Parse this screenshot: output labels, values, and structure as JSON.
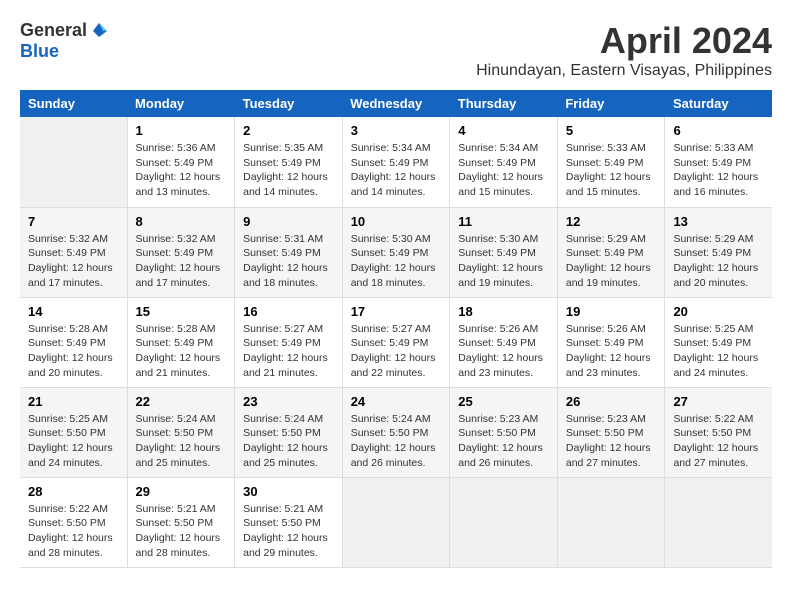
{
  "header": {
    "logo_general": "General",
    "logo_blue": "Blue",
    "month_title": "April 2024",
    "location": "Hinundayan, Eastern Visayas, Philippines"
  },
  "days_of_week": [
    "Sunday",
    "Monday",
    "Tuesday",
    "Wednesday",
    "Thursday",
    "Friday",
    "Saturday"
  ],
  "weeks": [
    [
      {
        "day": "",
        "info": ""
      },
      {
        "day": "1",
        "info": "Sunrise: 5:36 AM\nSunset: 5:49 PM\nDaylight: 12 hours\nand 13 minutes."
      },
      {
        "day": "2",
        "info": "Sunrise: 5:35 AM\nSunset: 5:49 PM\nDaylight: 12 hours\nand 14 minutes."
      },
      {
        "day": "3",
        "info": "Sunrise: 5:34 AM\nSunset: 5:49 PM\nDaylight: 12 hours\nand 14 minutes."
      },
      {
        "day": "4",
        "info": "Sunrise: 5:34 AM\nSunset: 5:49 PM\nDaylight: 12 hours\nand 15 minutes."
      },
      {
        "day": "5",
        "info": "Sunrise: 5:33 AM\nSunset: 5:49 PM\nDaylight: 12 hours\nand 15 minutes."
      },
      {
        "day": "6",
        "info": "Sunrise: 5:33 AM\nSunset: 5:49 PM\nDaylight: 12 hours\nand 16 minutes."
      }
    ],
    [
      {
        "day": "7",
        "info": "Sunrise: 5:32 AM\nSunset: 5:49 PM\nDaylight: 12 hours\nand 17 minutes."
      },
      {
        "day": "8",
        "info": "Sunrise: 5:32 AM\nSunset: 5:49 PM\nDaylight: 12 hours\nand 17 minutes."
      },
      {
        "day": "9",
        "info": "Sunrise: 5:31 AM\nSunset: 5:49 PM\nDaylight: 12 hours\nand 18 minutes."
      },
      {
        "day": "10",
        "info": "Sunrise: 5:30 AM\nSunset: 5:49 PM\nDaylight: 12 hours\nand 18 minutes."
      },
      {
        "day": "11",
        "info": "Sunrise: 5:30 AM\nSunset: 5:49 PM\nDaylight: 12 hours\nand 19 minutes."
      },
      {
        "day": "12",
        "info": "Sunrise: 5:29 AM\nSunset: 5:49 PM\nDaylight: 12 hours\nand 19 minutes."
      },
      {
        "day": "13",
        "info": "Sunrise: 5:29 AM\nSunset: 5:49 PM\nDaylight: 12 hours\nand 20 minutes."
      }
    ],
    [
      {
        "day": "14",
        "info": "Sunrise: 5:28 AM\nSunset: 5:49 PM\nDaylight: 12 hours\nand 20 minutes."
      },
      {
        "day": "15",
        "info": "Sunrise: 5:28 AM\nSunset: 5:49 PM\nDaylight: 12 hours\nand 21 minutes."
      },
      {
        "day": "16",
        "info": "Sunrise: 5:27 AM\nSunset: 5:49 PM\nDaylight: 12 hours\nand 21 minutes."
      },
      {
        "day": "17",
        "info": "Sunrise: 5:27 AM\nSunset: 5:49 PM\nDaylight: 12 hours\nand 22 minutes."
      },
      {
        "day": "18",
        "info": "Sunrise: 5:26 AM\nSunset: 5:49 PM\nDaylight: 12 hours\nand 23 minutes."
      },
      {
        "day": "19",
        "info": "Sunrise: 5:26 AM\nSunset: 5:49 PM\nDaylight: 12 hours\nand 23 minutes."
      },
      {
        "day": "20",
        "info": "Sunrise: 5:25 AM\nSunset: 5:49 PM\nDaylight: 12 hours\nand 24 minutes."
      }
    ],
    [
      {
        "day": "21",
        "info": "Sunrise: 5:25 AM\nSunset: 5:50 PM\nDaylight: 12 hours\nand 24 minutes."
      },
      {
        "day": "22",
        "info": "Sunrise: 5:24 AM\nSunset: 5:50 PM\nDaylight: 12 hours\nand 25 minutes."
      },
      {
        "day": "23",
        "info": "Sunrise: 5:24 AM\nSunset: 5:50 PM\nDaylight: 12 hours\nand 25 minutes."
      },
      {
        "day": "24",
        "info": "Sunrise: 5:24 AM\nSunset: 5:50 PM\nDaylight: 12 hours\nand 26 minutes."
      },
      {
        "day": "25",
        "info": "Sunrise: 5:23 AM\nSunset: 5:50 PM\nDaylight: 12 hours\nand 26 minutes."
      },
      {
        "day": "26",
        "info": "Sunrise: 5:23 AM\nSunset: 5:50 PM\nDaylight: 12 hours\nand 27 minutes."
      },
      {
        "day": "27",
        "info": "Sunrise: 5:22 AM\nSunset: 5:50 PM\nDaylight: 12 hours\nand 27 minutes."
      }
    ],
    [
      {
        "day": "28",
        "info": "Sunrise: 5:22 AM\nSunset: 5:50 PM\nDaylight: 12 hours\nand 28 minutes."
      },
      {
        "day": "29",
        "info": "Sunrise: 5:21 AM\nSunset: 5:50 PM\nDaylight: 12 hours\nand 28 minutes."
      },
      {
        "day": "30",
        "info": "Sunrise: 5:21 AM\nSunset: 5:50 PM\nDaylight: 12 hours\nand 29 minutes."
      },
      {
        "day": "",
        "info": ""
      },
      {
        "day": "",
        "info": ""
      },
      {
        "day": "",
        "info": ""
      },
      {
        "day": "",
        "info": ""
      }
    ]
  ]
}
